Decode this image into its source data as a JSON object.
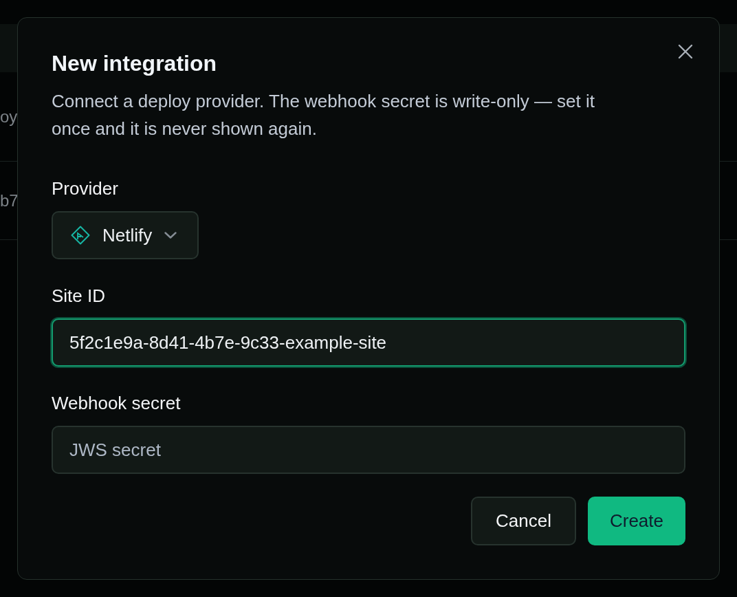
{
  "background_page": {
    "rows": [
      {
        "cell": "oy"
      },
      {
        "cell": "b7"
      }
    ]
  },
  "dialog": {
    "title": "New integration",
    "description": "Connect a deploy provider. The webhook secret is write-only — set it once and it is never shown again.",
    "fields": [
      {
        "kind": "select",
        "label": "Provider",
        "value": "Netlify"
      },
      {
        "kind": "text",
        "label": "Site ID",
        "value": "5f2c1e9a-8d41-4b7e-9c33-example-site",
        "focused": true
      },
      {
        "kind": "text",
        "label": "Webhook secret",
        "placeholder": "JWS secret",
        "focused": false
      }
    ],
    "buttons": [
      {
        "label": "Cancel",
        "kind": "secondary"
      },
      {
        "label": "Create",
        "kind": "primary"
      }
    ]
  }
}
